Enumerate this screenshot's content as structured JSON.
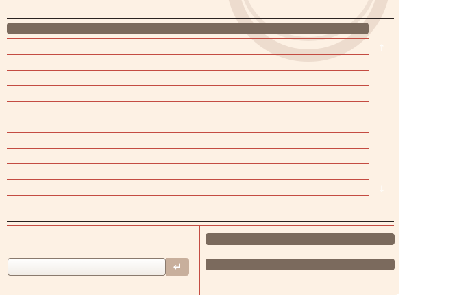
{
  "icons": {
    "scroll_up": "arrow-up-icon",
    "scroll_down": "arrow-down-icon",
    "enter": "return-icon"
  },
  "glyphs": {
    "scroll_up": "↑",
    "scroll_down": "↓",
    "enter": "↵"
  },
  "colors": {
    "panel_background": "#fdf1e4",
    "header_bar": "#7b6a5d",
    "rule_red": "#c44c42",
    "rule_dark": "#2a2220",
    "enter_button": "#c8af9c"
  },
  "list": {
    "header": "",
    "rows": [
      "",
      "",
      "",
      "",
      "",
      "",
      "",
      "",
      "",
      "",
      ""
    ]
  },
  "chat": {
    "input_value": "",
    "input_placeholder": ""
  },
  "side_panel": {
    "bar_1": "",
    "bar_2": ""
  }
}
